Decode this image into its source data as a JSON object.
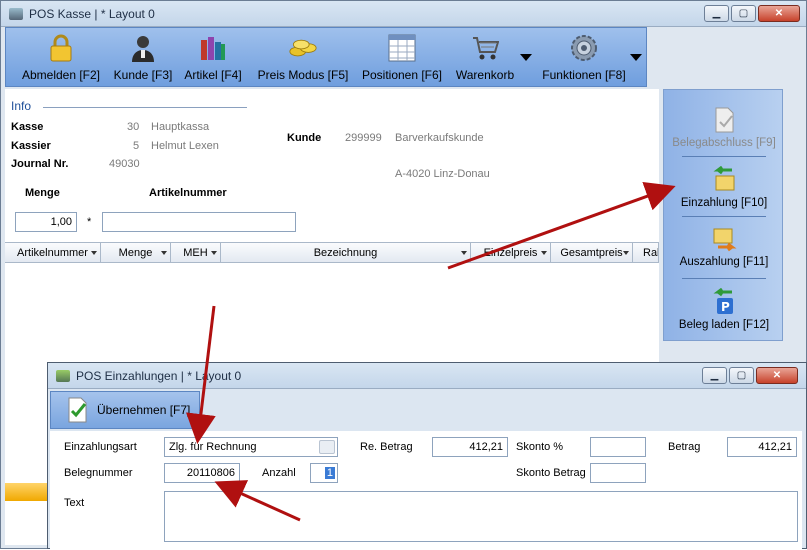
{
  "main_window": {
    "title": "POS Kasse | * Layout 0",
    "toolbar": [
      {
        "label": "Abmelden [F2]",
        "icon": "lock-icon"
      },
      {
        "label": "Kunde [F3]",
        "icon": "person-icon"
      },
      {
        "label": "Artikel [F4]",
        "icon": "books-icon"
      },
      {
        "label": "Preis Modus [F5]",
        "icon": "coins-icon"
      },
      {
        "label": "Positionen [F6]",
        "icon": "table-icon"
      },
      {
        "label": "Warenkorb",
        "icon": "cart-icon"
      },
      {
        "label": "Funktionen [F8]",
        "icon": "gear-icon"
      }
    ],
    "info": {
      "heading": "Info",
      "kasse_label": "Kasse",
      "kasse_nr": "30",
      "kasse_name": "Hauptkassa",
      "kassier_label": "Kassier",
      "kassier_nr": "5",
      "kassier_name": "Helmut Lexen",
      "journal_label": "Journal Nr.",
      "journal_nr": "49030",
      "kunde_label": "Kunde",
      "kunde_nr": "299999",
      "kunde_name": "Barverkaufskunde",
      "kunde_ort": "A-4020 Linz-Donau"
    },
    "entry": {
      "menge_label": "Menge",
      "artikel_label": "Artikelnummer",
      "menge_value": "1,00",
      "times": "*",
      "artikel_value": ""
    },
    "grid_columns": [
      "Artikelnummer",
      "Menge",
      "MEH",
      "Bezeichnung",
      "Einzelpreis",
      "Gesamtpreis",
      "Rab"
    ],
    "side_buttons": [
      {
        "label": "Belegabschluss [F9]",
        "icon": "document-check-icon"
      },
      {
        "label": "Einzahlung [F10]",
        "icon": "deposit-icon"
      },
      {
        "label": "Auszahlung [F11]",
        "icon": "withdrawal-icon"
      },
      {
        "label": "Beleg laden [F12]",
        "icon": "parking-load-icon"
      }
    ]
  },
  "dialog": {
    "title": "POS Einzahlungen | * Layout 0",
    "apply_label": "Übernehmen [F7]",
    "einzahlungsart_label": "Einzahlungsart",
    "einzahlungsart_value": "Zlg. für Rechnung",
    "belegnummer_label": "Belegnummer",
    "belegnummer_value": "20110806",
    "anzahl_label": "Anzahl",
    "anzahl_value": "1",
    "re_betrag_label": "Re. Betrag",
    "re_betrag_value": "412,21",
    "skonto_pct_label": "Skonto %",
    "skonto_pct_value": "",
    "betrag_label": "Betrag",
    "betrag_value": "412,21",
    "skonto_betrag_label": "Skonto Betrag",
    "skonto_betrag_value": "",
    "text_label": "Text",
    "text_value": ""
  },
  "colors": {
    "toolbar": "#7fa8e1",
    "arrow": "#b01010",
    "highlight": "#3a7bd5"
  }
}
